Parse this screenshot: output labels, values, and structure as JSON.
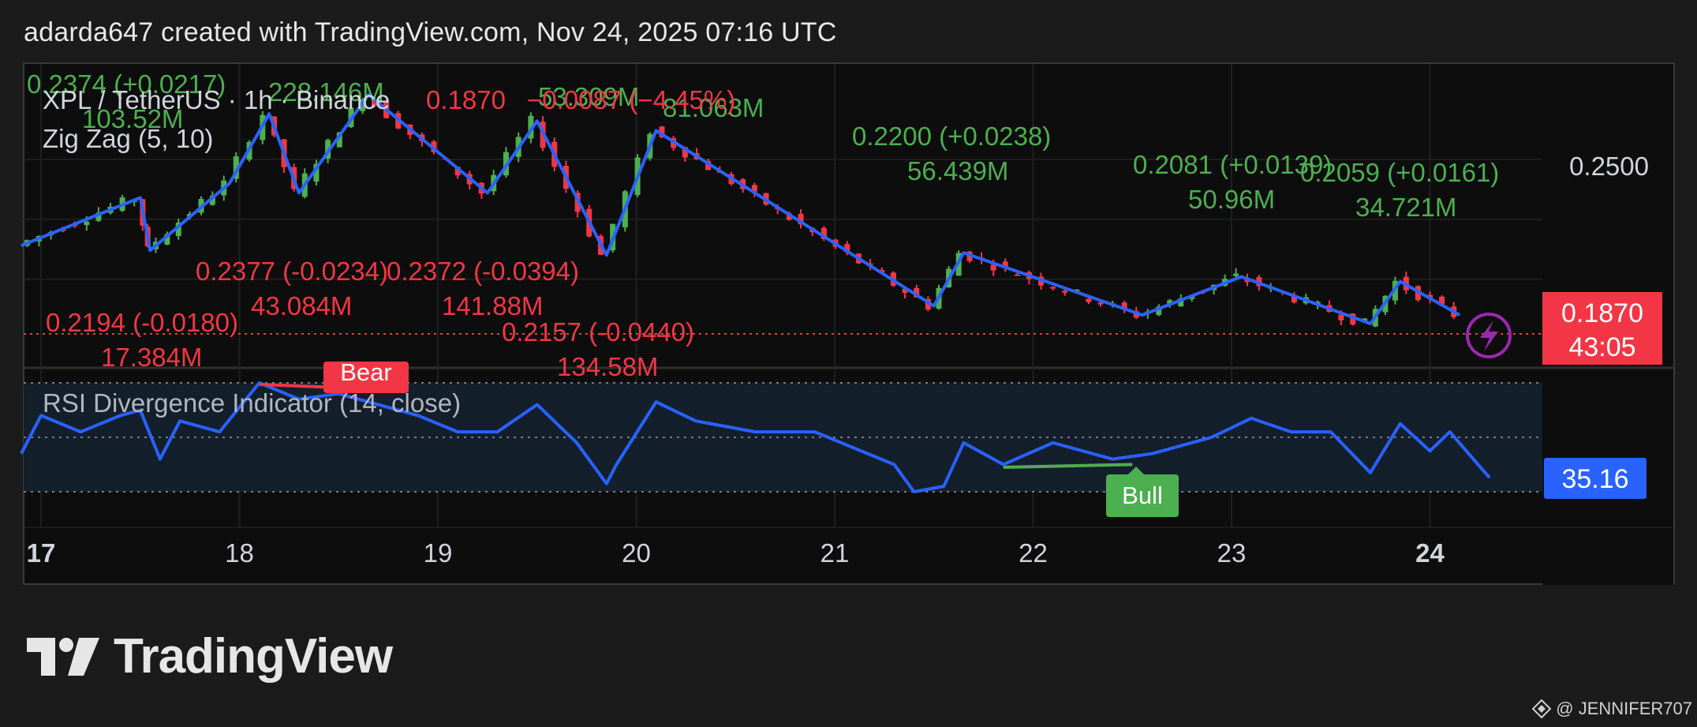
{
  "header": {
    "caption": "adarda647 created with TradingView.com, Nov 24, 2025 07:16 UTC"
  },
  "symbol_line": {
    "symbol": "XPL / TetherUS · 1h · Binance",
    "last": "0.1870",
    "change": "−0.0087 (−4.45%)"
  },
  "indicators": {
    "zigzag": "Zig Zag (5, 10)",
    "rsi": "RSI Divergence Indicator (14, close)"
  },
  "price_scale": {
    "tick": "0.2500",
    "current_price": "0.1870",
    "countdown": "43:05"
  },
  "rsi_scale": {
    "current": "35.16"
  },
  "divergence_labels": {
    "bear": "Bear",
    "bull": "Bull"
  },
  "zigzag_labels": [
    {
      "line1": "0.2374 (+0.0217)",
      "line2": "103.52M",
      "color": "green"
    },
    {
      "line1": "",
      "line2": "228.146M",
      "color": "green"
    },
    {
      "line1": "",
      "line2": "53.309M",
      "color": "green"
    },
    {
      "line1": "",
      "line2": "81.063M",
      "color": "green"
    },
    {
      "line1": "0.2200 (+0.0238)",
      "line2": "56.439M",
      "color": "green"
    },
    {
      "line1": "0.2081 (+0.0139)",
      "line2": "50.96M",
      "color": "green"
    },
    {
      "line1": "0.2059 (+0.0161)",
      "line2": "34.721M",
      "color": "green"
    },
    {
      "line1": "0.2377 (-0.0234)",
      "line2": "43.084M",
      "color": "red"
    },
    {
      "line1": "0.2372 (-0.0394)",
      "line2": "141.88M",
      "color": "red"
    },
    {
      "line1": "0.2194 (-0.0180)",
      "line2": "17.384M",
      "color": "red"
    },
    {
      "line1": "0.2157 (-0.0440)",
      "line2": "134.58M",
      "color": "red"
    }
  ],
  "brand": {
    "name": "TradingView"
  },
  "watermark": {
    "text": "@ JENNIFER707"
  },
  "colors": {
    "background": "#1b1b1b",
    "pane": "#0d0d0d",
    "up": "#4caf50",
    "down": "#f23645",
    "zigzag": "#2962ff",
    "rsi": "#2962ff",
    "rsi_band": "#141f2c",
    "bull_line": "#4caf50",
    "bear_line": "#f23645",
    "text": "#b2b5be"
  },
  "chart_data": {
    "type": "candlestick",
    "title": "XPL / TetherUS · 1h · Binance",
    "x_ticks": [
      "17",
      "18",
      "19",
      "20",
      "21",
      "22",
      "23",
      "24"
    ],
    "y_ticks": [
      "0.2500"
    ],
    "zigzag_pivots": [
      {
        "day": 16.9,
        "price": 0.232
      },
      {
        "day": 17.5,
        "price": 0.242
      },
      {
        "day": 17.55,
        "price": 0.231
      },
      {
        "day": 17.95,
        "price": 0.245
      },
      {
        "day": 18.15,
        "price": 0.2595
      },
      {
        "day": 18.3,
        "price": 0.243
      },
      {
        "day": 18.65,
        "price": 0.2635
      },
      {
        "day": 19.25,
        "price": 0.243
      },
      {
        "day": 19.5,
        "price": 0.258
      },
      {
        "day": 19.85,
        "price": 0.23
      },
      {
        "day": 20.1,
        "price": 0.256
      },
      {
        "day": 21.5,
        "price": 0.2194
      },
      {
        "day": 21.65,
        "price": 0.2305
      },
      {
        "day": 22.55,
        "price": 0.2175
      },
      {
        "day": 23.05,
        "price": 0.2255
      },
      {
        "day": 23.7,
        "price": 0.2157
      },
      {
        "day": 23.85,
        "price": 0.2245
      },
      {
        "day": 24.15,
        "price": 0.2175
      }
    ],
    "last_price": 0.187,
    "rsi": {
      "length": 14,
      "source": "close",
      "last": 35.16,
      "series": [
        {
          "day": 16.9,
          "rsi": 44
        },
        {
          "day": 17.0,
          "rsi": 58
        },
        {
          "day": 17.2,
          "rsi": 52
        },
        {
          "day": 17.4,
          "rsi": 58
        },
        {
          "day": 17.5,
          "rsi": 60
        },
        {
          "day": 17.6,
          "rsi": 42
        },
        {
          "day": 17.7,
          "rsi": 56
        },
        {
          "day": 17.9,
          "rsi": 52
        },
        {
          "day": 18.1,
          "rsi": 70
        },
        {
          "day": 18.3,
          "rsi": 64
        },
        {
          "day": 18.5,
          "rsi": 66
        },
        {
          "day": 18.7,
          "rsi": 62
        },
        {
          "day": 18.9,
          "rsi": 58
        },
        {
          "day": 19.1,
          "rsi": 52
        },
        {
          "day": 19.3,
          "rsi": 52
        },
        {
          "day": 19.5,
          "rsi": 62
        },
        {
          "day": 19.7,
          "rsi": 48
        },
        {
          "day": 19.85,
          "rsi": 33
        },
        {
          "day": 19.9,
          "rsi": 40
        },
        {
          "day": 20.1,
          "rsi": 63
        },
        {
          "day": 20.3,
          "rsi": 56
        },
        {
          "day": 20.6,
          "rsi": 52
        },
        {
          "day": 20.9,
          "rsi": 52
        },
        {
          "day": 21.1,
          "rsi": 46
        },
        {
          "day": 21.3,
          "rsi": 40
        },
        {
          "day": 21.4,
          "rsi": 30
        },
        {
          "day": 21.55,
          "rsi": 32
        },
        {
          "day": 21.65,
          "rsi": 48
        },
        {
          "day": 21.85,
          "rsi": 40
        },
        {
          "day": 22.1,
          "rsi": 48
        },
        {
          "day": 22.4,
          "rsi": 42
        },
        {
          "day": 22.6,
          "rsi": 44
        },
        {
          "day": 22.9,
          "rsi": 50
        },
        {
          "day": 23.1,
          "rsi": 57
        },
        {
          "day": 23.3,
          "rsi": 52
        },
        {
          "day": 23.5,
          "rsi": 52
        },
        {
          "day": 23.7,
          "rsi": 37
        },
        {
          "day": 23.85,
          "rsi": 55
        },
        {
          "day": 24.0,
          "rsi": 45
        },
        {
          "day": 24.1,
          "rsi": 52
        },
        {
          "day": 24.3,
          "rsi": 35.16
        }
      ],
      "bear_divergence": {
        "from_day": 18.1,
        "to_day": 18.6
      },
      "bull_divergence": {
        "from_day": 21.85,
        "to_day": 22.5
      }
    }
  }
}
